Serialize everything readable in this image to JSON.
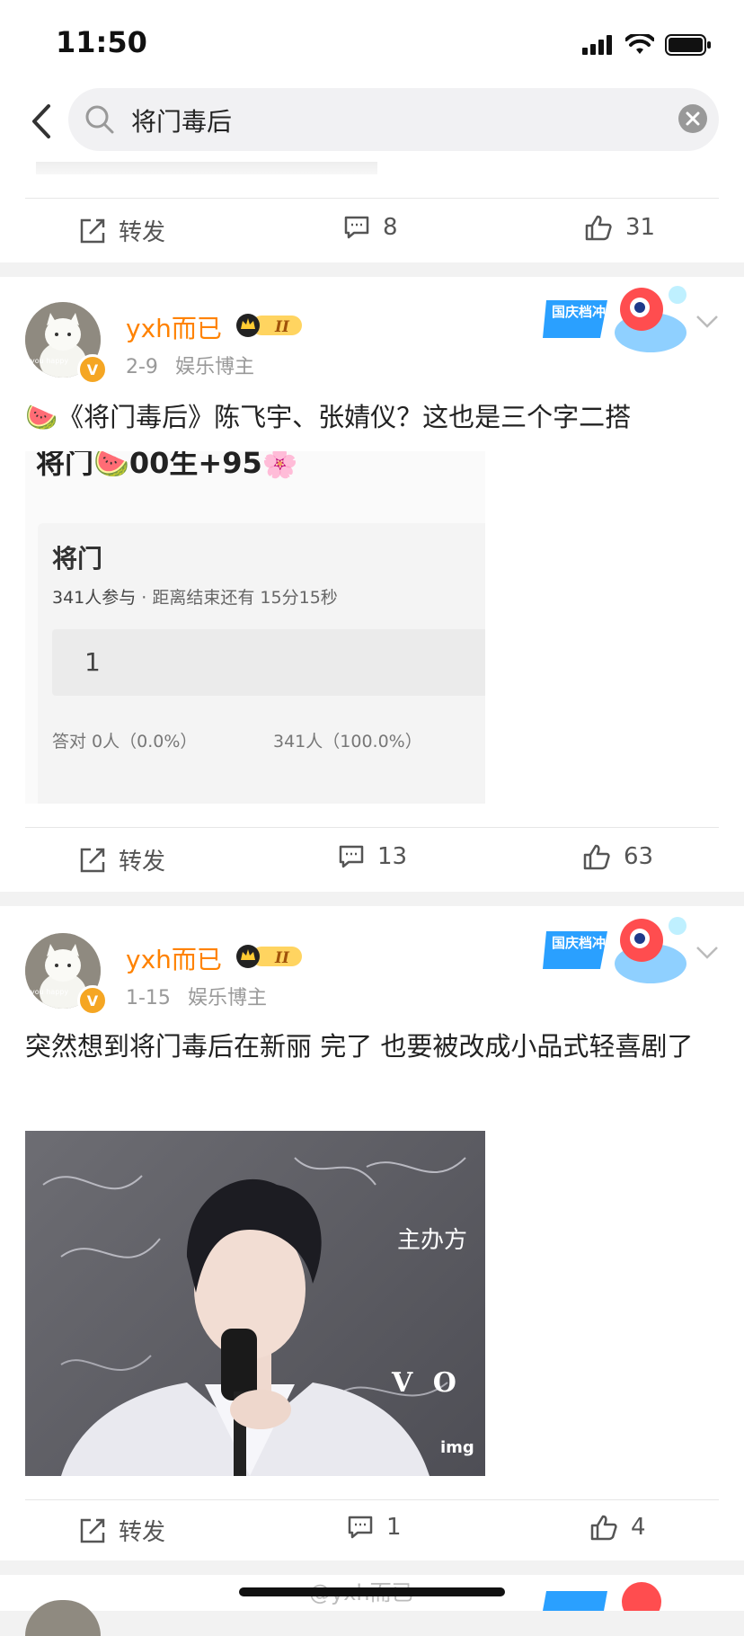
{
  "status": {
    "time": "11:50"
  },
  "search": {
    "query": "将门毒后"
  },
  "posts": [
    {
      "actions": {
        "repost": "转发",
        "comments": "8",
        "likes": "31"
      }
    },
    {
      "user": "yxh而已",
      "date": "2-9",
      "category": "娱乐博主",
      "level": "II",
      "badge_text": "国庆档冲浪大师",
      "text": "🍉《将门毒后》陈飞宇、张婧仪？这也是三个字二搭",
      "quiz": {
        "header": "将门🍉00生+95🌸",
        "title": "将门",
        "participants": "341人参与",
        "ends": "距离结束还有 15分15秒",
        "option": "1",
        "correct": "答对 0人（0.0%）",
        "wrong": "341人（100.0%）"
      },
      "actions": {
        "repost": "转发",
        "comments": "13",
        "likes": "63"
      }
    },
    {
      "user": "yxh而已",
      "date": "1-15",
      "category": "娱乐博主",
      "level": "II",
      "badge_text": "国庆档冲浪大师",
      "text": "突然想到将门毒后在新丽 完了 也要被改成小品式轻喜剧了",
      "photo_text": {
        "sponsor": "主办方",
        "brand": "V O",
        "watermark": "img"
      },
      "actions": {
        "repost": "转发",
        "comments": "1",
        "likes": "4"
      }
    }
  ],
  "avatar_text": "you happy",
  "footer_watermark": "@yxh而已",
  "colors": {
    "accent": "#ff8200",
    "vip": "#f5a623",
    "link": "#507daf"
  }
}
